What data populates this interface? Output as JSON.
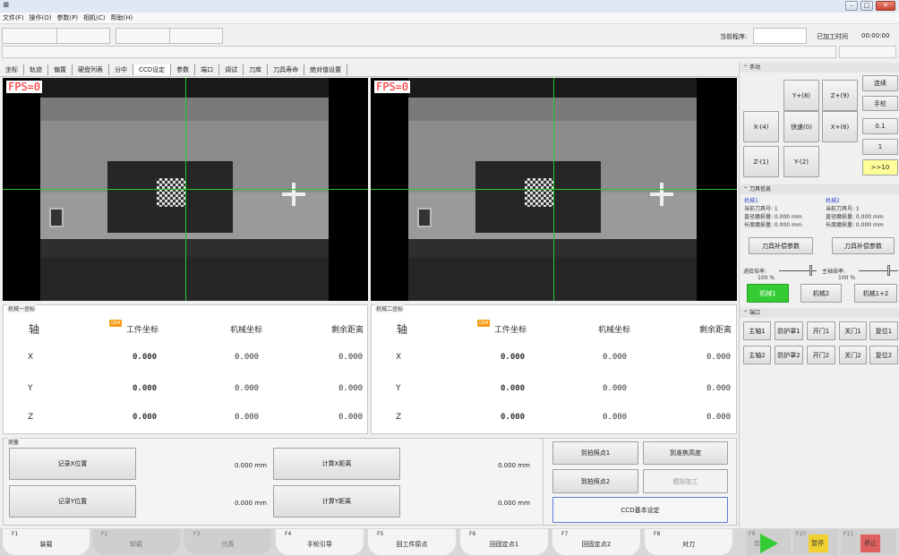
{
  "window": {
    "icon_glyph": "≡",
    "min": "–",
    "max": "□",
    "close": "✕"
  },
  "menu": [
    "文件(F)",
    "操作(O)",
    "参数(P)",
    "相机(C)",
    "帮助(H)"
  ],
  "toolbar": {
    "program_label": "当前程序:",
    "time_label": "已加工时间",
    "time_value": "00:00:00"
  },
  "tabs": [
    "坐标",
    "轨迹",
    "偏置",
    "硬盘列表",
    "分中",
    "CCD设定",
    "参数",
    "端口",
    "调试",
    "刀库",
    "刀具寿命",
    "绝对值设置"
  ],
  "cameras": [
    {
      "fps": "FPS=0",
      "group": "机械一坐标"
    },
    {
      "fps": "FPS=0",
      "group": "机械二坐标"
    }
  ],
  "coord": {
    "axis_h": "轴",
    "g54": "G54",
    "work_h": "工件坐标",
    "mach_h": "机械坐标",
    "remain_h": "剩余距离",
    "rows": [
      {
        "axis": "X",
        "work": "0.000",
        "mach": "0.000",
        "remain": "0.000"
      },
      {
        "axis": "Y",
        "work": "0.000",
        "mach": "0.000",
        "remain": "0.000"
      },
      {
        "axis": "Z",
        "work": "0.000",
        "mach": "0.000",
        "remain": "0.000"
      }
    ]
  },
  "measure": {
    "title": "测量",
    "rec_x": "记录X位置",
    "rec_y": "记录Y位置",
    "pos_x": "0.000 mm",
    "pos_y": "0.000 mm",
    "calc_x": "计算X距离",
    "calc_y": "计算Y距离",
    "dist_x": "0.000 mm",
    "dist_y": "0.000 mm",
    "photo1": "到拍照点1",
    "focus": "到准焦高度",
    "photo2": "到拍照点2",
    "sim": "模拟加工",
    "ccd": "CCD基本设定"
  },
  "manual": {
    "title": "手动",
    "yp": "Y+(8)",
    "zp": "Z+(9)",
    "xm": "X-(4)",
    "fast": "快速(0)",
    "xp": "X+(6)",
    "zm": "Z-(1)",
    "ym": "Y-(2)",
    "cont": "连续",
    "wheel": "手轮",
    "s01": "0.1",
    "s1": "1",
    "s10": ">>10"
  },
  "tool": {
    "title": "刀具信息",
    "m1": "机械1",
    "m2": "机械2",
    "cur1": "当前刀具号: 1",
    "cur2": "当前刀具号: 1",
    "dia1": "直径磨损量: 0.000 mm",
    "dia2": "直径磨损量: 0.000 mm",
    "len1": "长度磨损量: 0.000 mm",
    "len2": "长度磨损量: 0.000 mm",
    "comp": "刀具补偿参数"
  },
  "rates": {
    "feed": "进给倍率:",
    "feed_v": "100 %",
    "spin": "主轴倍率:",
    "spin_v": "100 %"
  },
  "machines": {
    "a": "机械1",
    "b": "机械2",
    "ab": "机械1+2"
  },
  "port": {
    "title": "端口",
    "r1": [
      "主轴1",
      "防护罩1",
      "开门1",
      "关门1",
      "复位1"
    ],
    "r2": [
      "主轴2",
      "防护罩2",
      "开门2",
      "关门2",
      "复位2"
    ]
  },
  "fkeys": [
    {
      "n": "F1",
      "l": "装载"
    },
    {
      "n": "F2",
      "l": "卸载"
    },
    {
      "n": "F3",
      "l": "仿真"
    },
    {
      "n": "F4",
      "l": "手轮引导"
    },
    {
      "n": "F5",
      "l": "回工件原点"
    },
    {
      "n": "F6",
      "l": "回固定点1"
    },
    {
      "n": "F7",
      "l": "回固定点2"
    },
    {
      "n": "F8",
      "l": "对刀"
    },
    {
      "n": "F9",
      "l": "启动"
    },
    {
      "n": "F10",
      "l": "暂停"
    },
    {
      "n": "F11",
      "l": "停止"
    }
  ],
  "colors": {
    "green": "#33cc33",
    "yellow": "#ffff99",
    "crosshair": "#22cc22",
    "fps": "#ff2020"
  }
}
